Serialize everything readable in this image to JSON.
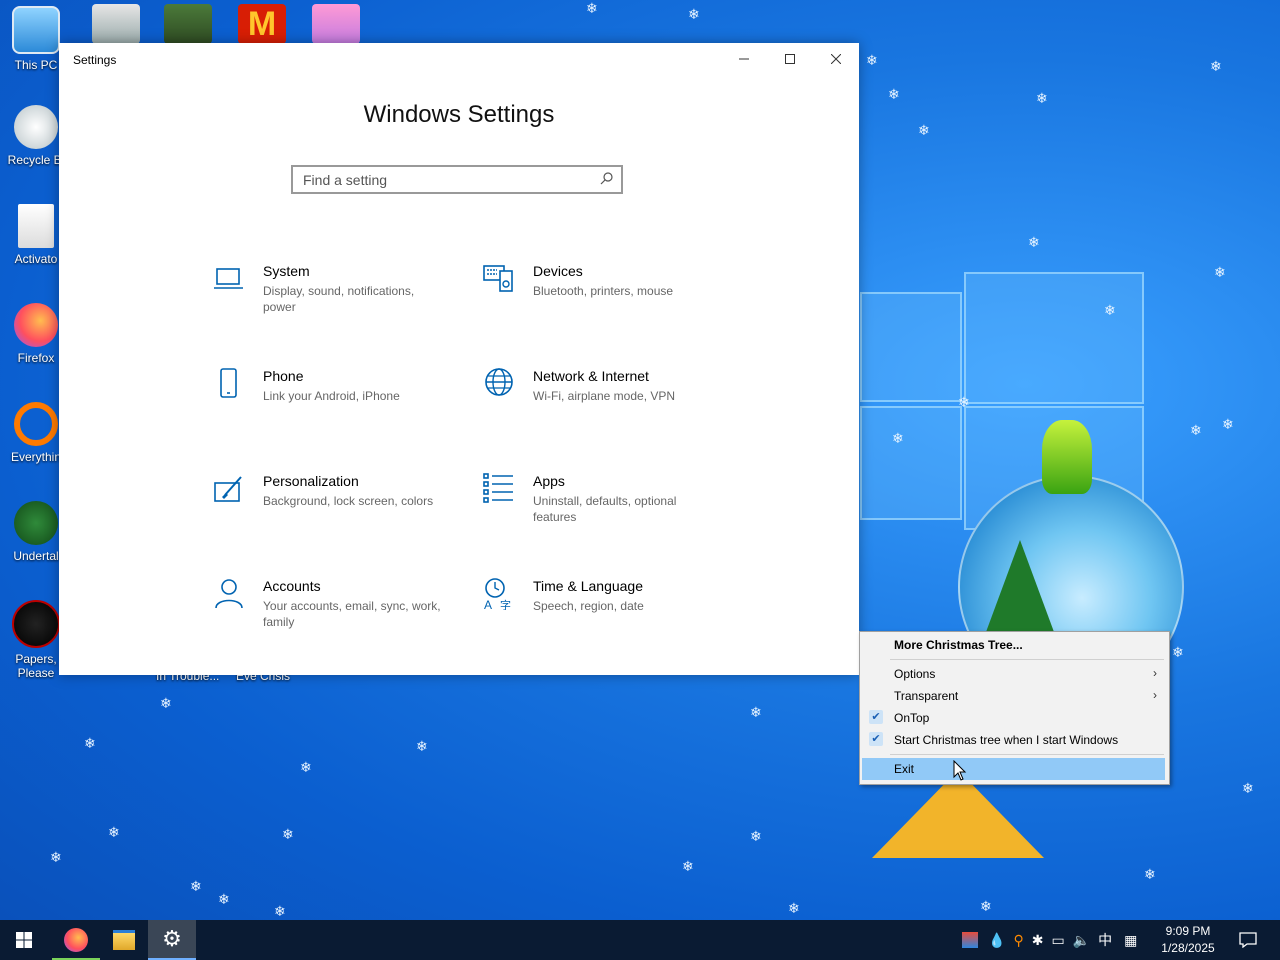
{
  "desktop": {
    "icons": [
      {
        "label": "This PC"
      },
      {
        "label": "Recycle Bi"
      },
      {
        "label": "Activato"
      },
      {
        "label": "Firefox"
      },
      {
        "label": "Everythin"
      },
      {
        "label": "Undertal"
      },
      {
        "label": "Papers, Please"
      }
    ],
    "partial_labels": [
      "In Trouble...",
      "Eve Crisis"
    ]
  },
  "settings_window": {
    "title": "Settings",
    "heading": "Windows Settings",
    "search_placeholder": "Find a setting",
    "categories": [
      {
        "name": "System",
        "desc": "Display, sound, notifications, power",
        "icon": "laptop-icon"
      },
      {
        "name": "Devices",
        "desc": "Bluetooth, printers, mouse",
        "icon": "keyboard-speaker-icon"
      },
      {
        "name": "Phone",
        "desc": "Link your Android, iPhone",
        "icon": "phone-icon"
      },
      {
        "name": "Network & Internet",
        "desc": "Wi-Fi, airplane mode, VPN",
        "icon": "globe-icon"
      },
      {
        "name": "Personalization",
        "desc": "Background, lock screen, colors",
        "icon": "paintbrush-icon"
      },
      {
        "name": "Apps",
        "desc": "Uninstall, defaults, optional features",
        "icon": "apps-list-icon"
      },
      {
        "name": "Accounts",
        "desc": "Your accounts, email, sync, work, family",
        "icon": "person-icon"
      },
      {
        "name": "Time & Language",
        "desc": "Speech, region, date",
        "icon": "time-language-icon"
      }
    ]
  },
  "context_menu": {
    "items": [
      {
        "label": "More Christmas Tree...",
        "bold": true
      },
      {
        "label": "Options",
        "submenu": true
      },
      {
        "label": "Transparent",
        "submenu": true
      },
      {
        "label": "OnTop",
        "checked": true
      },
      {
        "label": "Start Christmas tree when I start Windows",
        "checked": true
      },
      {
        "label": "Exit",
        "highlighted": true
      }
    ]
  },
  "taskbar": {
    "apps": [
      "start-button",
      "firefox",
      "file-explorer",
      "settings"
    ],
    "ime_label": "中",
    "clock_time": "9:09 PM",
    "clock_date": "1/28/2025"
  },
  "colors": {
    "accent": "#0063b1",
    "desktop_blue": "#1976e0",
    "menu_highlight": "#91c9f7",
    "taskbar": "#0a1b33"
  }
}
